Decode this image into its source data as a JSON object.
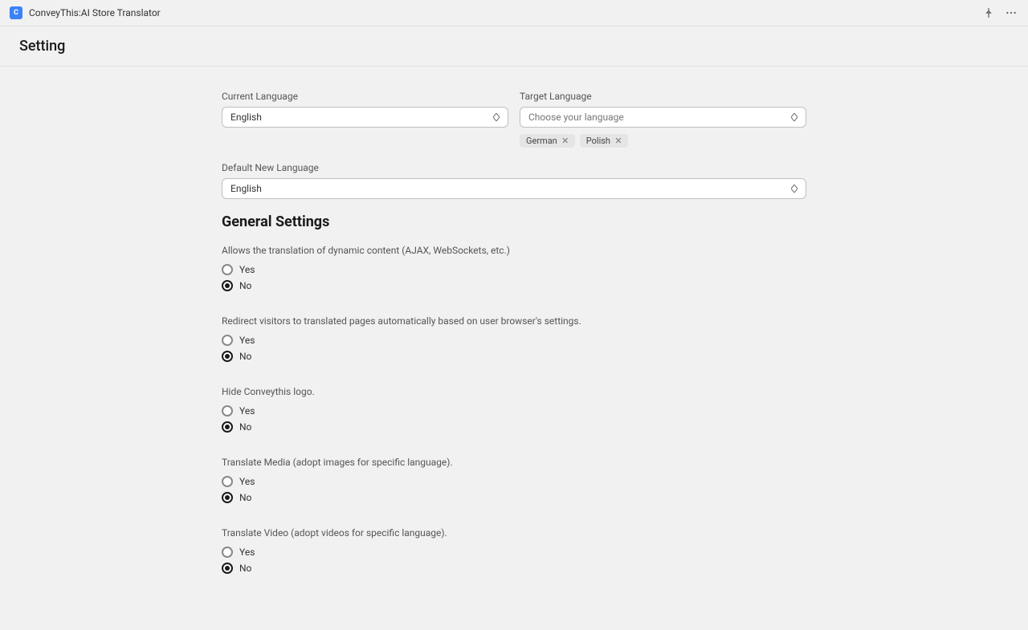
{
  "titlebar": {
    "app_name": "ConveyThis:AI Store Translator"
  },
  "header": {
    "title": "Setting"
  },
  "fields": {
    "current_language": {
      "label": "Current Language",
      "value": "English"
    },
    "target_language": {
      "label": "Target Language",
      "placeholder": "Choose your language",
      "tags": [
        "German",
        "Polish"
      ]
    },
    "default_new_language": {
      "label": "Default New Language",
      "value": "English"
    }
  },
  "general": {
    "title": "General Settings",
    "yes": "Yes",
    "no": "No",
    "settings": [
      {
        "desc": "Allows the translation of dynamic content (AJAX, WebSockets, etc.)",
        "value": "No"
      },
      {
        "desc": "Redirect visitors to translated pages automatically based on user browser's settings.",
        "value": "No"
      },
      {
        "desc": "Hide Conveythis logo.",
        "value": "No"
      },
      {
        "desc": "Translate Media (adopt images for specific language).",
        "value": "No"
      },
      {
        "desc": "Translate Video (adopt videos for specific language).",
        "value": "No"
      }
    ]
  }
}
